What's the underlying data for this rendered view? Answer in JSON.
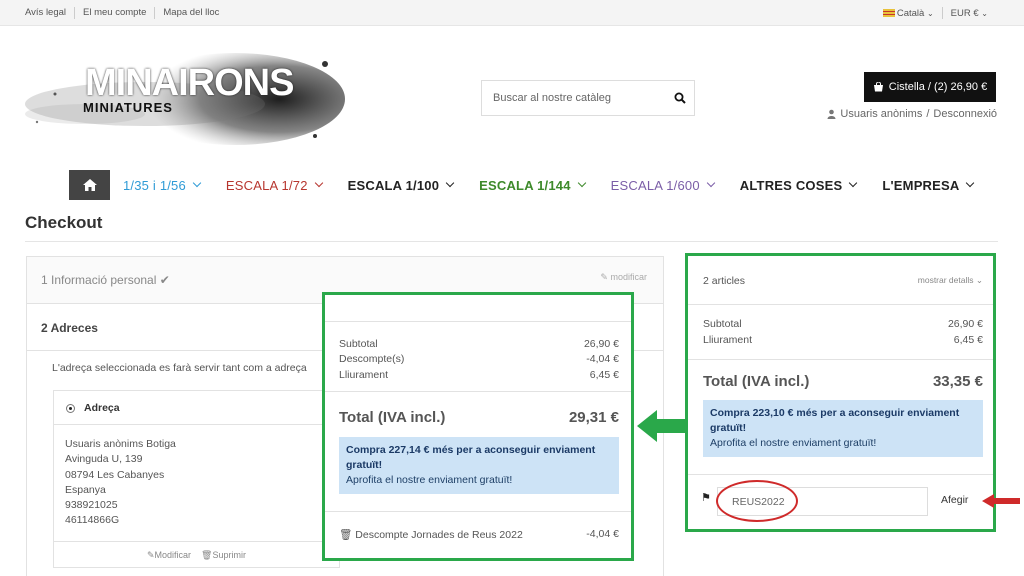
{
  "topbar": {
    "links": [
      "Avís legal",
      "El meu compte",
      "Mapa del lloc"
    ],
    "language": "Català",
    "currency": "EUR €"
  },
  "logo": {
    "brand": "MINAIRONS",
    "subtitle": "MINIATURES"
  },
  "search": {
    "placeholder": "Buscar al nostre catàleg"
  },
  "cart": {
    "label": "Cistella / (2) 26,90 €"
  },
  "user": {
    "name": "Usuaris anònims",
    "logout": "Desconnexió"
  },
  "nav": {
    "items": [
      {
        "label": "1/35 i 1/56",
        "color": "#2f9bd6"
      },
      {
        "label": "ESCALA 1/72",
        "color": "#b7362f"
      },
      {
        "label": "ESCALA 1/100",
        "color": "#222222"
      },
      {
        "label": "ESCALA 1/144",
        "color": "#3e8a2b"
      },
      {
        "label": "ESCALA 1/600",
        "color": "#7b5ea7"
      },
      {
        "label": "ALTRES COSES",
        "color": "#222222"
      },
      {
        "label": "L'EMPRESA",
        "color": "#222222"
      }
    ]
  },
  "page": {
    "title": "Checkout"
  },
  "checkout": {
    "step1": {
      "label": "1 Informació personal",
      "modify": "modificar"
    },
    "step2": {
      "label": "2 Adreces",
      "note": "L'adreça seleccionada es farà servir tant com a adreça",
      "address_title": "Adreça",
      "address_lines": [
        "Usuaris anònims Botiga",
        "Avinguda U, 139",
        "08794 Les Cabanyes",
        "Espanya",
        "938921025",
        "46114866G"
      ],
      "modify": "Modificar",
      "delete": "Suprimir"
    }
  },
  "summary_after": {
    "subtotal_label": "Subtotal",
    "subtotal": "26,90 €",
    "discount_label": "Descompte(s)",
    "discount": "-4,04 €",
    "shipping_label": "Lliurament",
    "shipping": "6,45 €",
    "total_label": "Total (IVA incl.)",
    "total": "29,31 €",
    "info_bold": "Compra 227,14 € més per a aconseguir enviament gratuït!",
    "info_text": "Aprofita el nostre enviament gratuït!",
    "voucher_label": "Descompte Jornades de Reus 2022",
    "voucher_value": "-4,04 €"
  },
  "summary_before": {
    "articles": "2 articles",
    "details": "mostrar detalls",
    "subtotal_label": "Subtotal",
    "subtotal": "26,90 €",
    "shipping_label": "Lliurament",
    "shipping": "6,45 €",
    "total_label": "Total (IVA incl.)",
    "total": "33,35 €",
    "info_bold": "Compra 223,10 € més per a aconseguir enviament gratuït!",
    "info_text": "Aprofita el nostre enviament gratuït!",
    "promo_code": "REUS2022",
    "add_label": "Afegir"
  },
  "colors": {
    "highlight_green": "#2aa84a",
    "annotation_red": "#cf2a2a",
    "info_blue": "#cde3f6"
  }
}
